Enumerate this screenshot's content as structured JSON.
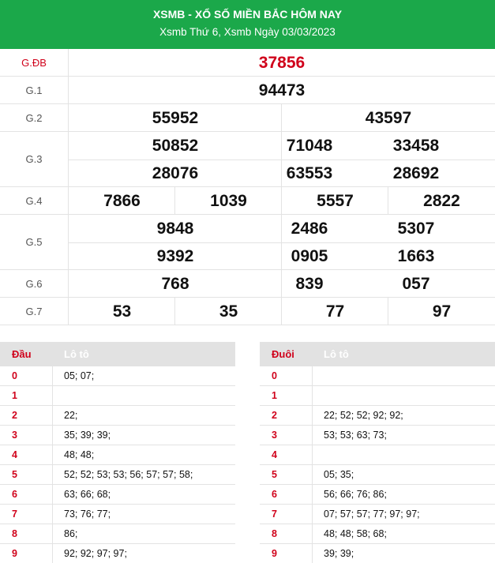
{
  "header": {
    "title": "XSMB - XỔ SỐ MIỀN BẮC HÔM NAY",
    "subtitle": "Xsmb Thứ 6, Xsmb Ngày 03/03/2023"
  },
  "prizes": [
    {
      "label": "G.ĐB",
      "numbers": [
        "37856"
      ]
    },
    {
      "label": "G.1",
      "numbers": [
        "94473"
      ]
    },
    {
      "label": "G.2",
      "numbers": [
        "55952",
        "43597"
      ]
    },
    {
      "label": "G.3",
      "numbers": [
        "50852",
        "71048",
        "33458",
        "28076",
        "63553",
        "28692"
      ]
    },
    {
      "label": "G.4",
      "numbers": [
        "7866",
        "1039",
        "5557",
        "2822"
      ]
    },
    {
      "label": "G.5",
      "numbers": [
        "9848",
        "2486",
        "5307",
        "9392",
        "0905",
        "1663"
      ]
    },
    {
      "label": "G.6",
      "numbers": [
        "768",
        "839",
        "057"
      ]
    },
    {
      "label": "G.7",
      "numbers": [
        "53",
        "35",
        "77",
        "97"
      ]
    }
  ],
  "loto_head": {
    "header_key": "Đầu",
    "header_value": "Lô tô",
    "rows": [
      {
        "key": "0",
        "value": "05; 07;"
      },
      {
        "key": "1",
        "value": ""
      },
      {
        "key": "2",
        "value": "22;"
      },
      {
        "key": "3",
        "value": "35; 39; 39;"
      },
      {
        "key": "4",
        "value": "48; 48;"
      },
      {
        "key": "5",
        "value": "52; 52; 53; 53; 56; 57; 57; 58;"
      },
      {
        "key": "6",
        "value": "63; 66; 68;"
      },
      {
        "key": "7",
        "value": "73; 76; 77;"
      },
      {
        "key": "8",
        "value": "86;"
      },
      {
        "key": "9",
        "value": "92; 92; 97; 97;"
      }
    ]
  },
  "loto_tail": {
    "header_key": "Đuôi",
    "header_value": "Lô tô",
    "rows": [
      {
        "key": "0",
        "value": ""
      },
      {
        "key": "1",
        "value": ""
      },
      {
        "key": "2",
        "value": "22; 52; 52; 92; 92;"
      },
      {
        "key": "3",
        "value": "53; 53; 63; 73;"
      },
      {
        "key": "4",
        "value": ""
      },
      {
        "key": "5",
        "value": "05; 35;"
      },
      {
        "key": "6",
        "value": "56; 66; 76; 86;"
      },
      {
        "key": "7",
        "value": "07; 57; 57; 77; 97; 97;"
      },
      {
        "key": "8",
        "value": "48; 48; 58; 68;"
      },
      {
        "key": "9",
        "value": "39; 39;"
      }
    ]
  },
  "colors": {
    "header_bg": "#1ba84a",
    "special": "#d0021b",
    "table_head_bg": "#e2e2e2"
  }
}
